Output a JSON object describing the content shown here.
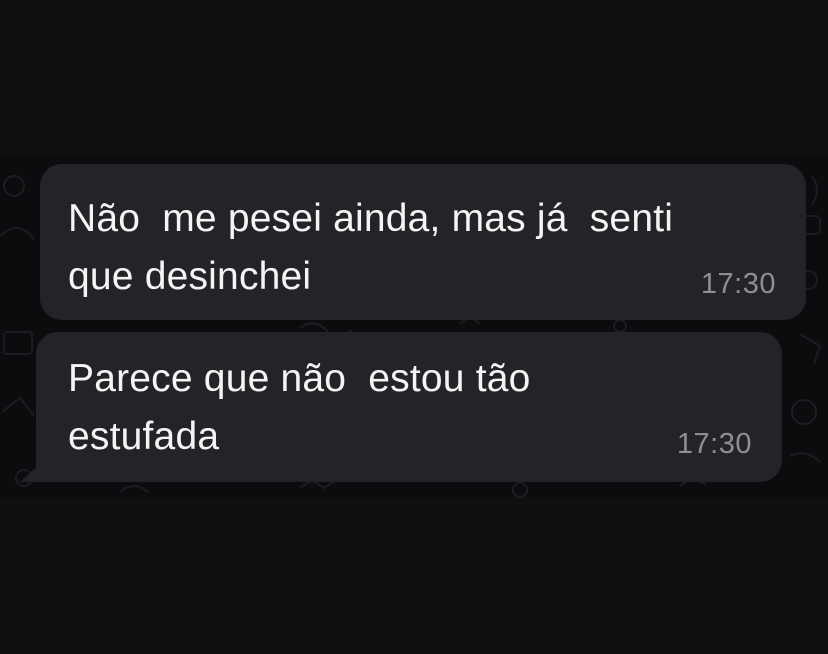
{
  "messages": [
    {
      "text": "Não  me pesei ainda, mas já  senti\nque desinchei",
      "time": "17:30"
    },
    {
      "text": "Parece que não  estou tão\nestufada",
      "time": "17:30"
    }
  ],
  "colors": {
    "background": "#101013",
    "wallpaper": "#0b0c0e",
    "bubble": "#232427",
    "text": "#f4f4f4",
    "time": "#8e8f93"
  }
}
